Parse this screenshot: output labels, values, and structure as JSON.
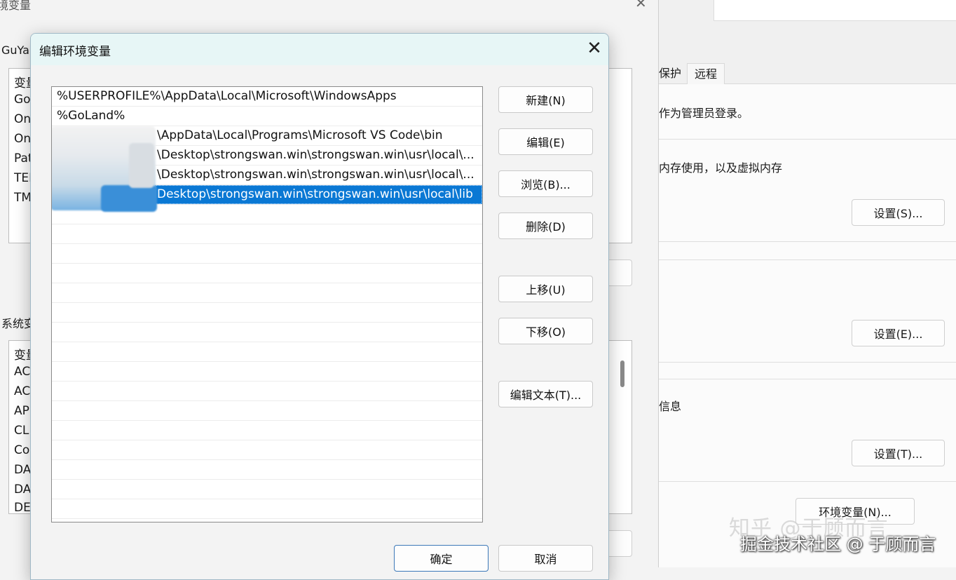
{
  "system_properties": {
    "tabs": [
      "保护",
      "远程"
    ],
    "admin_note": "作为管理员登录。",
    "performance_desc": "内存使用，以及虚拟内存",
    "performance_settings": "设置(S)...",
    "profiles_settings": "设置(E)...",
    "startup_desc": "信息",
    "startup_settings": "设置(T)...",
    "env_vars_button": "环境变量(N)..."
  },
  "env_dialog": {
    "title": "境变量",
    "user_section_label": "GuYa",
    "user_vars_header": "变量",
    "user_vars": [
      "Go",
      "On",
      "On",
      "Pat",
      "TEI",
      "TM"
    ],
    "system_section_label": "系统变",
    "system_vars_header": "变量",
    "system_vars": [
      "AC",
      "AC",
      "AP",
      "CLI",
      "Co",
      "DA",
      "DA",
      "DE"
    ]
  },
  "edit_dialog": {
    "title": "编辑环境变量",
    "paths": [
      {
        "text": "%USERPROFILE%\\AppData\\Local\\Microsoft\\WindowsApps",
        "selected": false
      },
      {
        "text": "%GoLand%",
        "selected": false
      },
      {
        "text": "\\AppData\\Local\\Programs\\Microsoft VS Code\\bin",
        "selected": false
      },
      {
        "text": "\\Desktop\\strongswan.win\\strongswan.win\\usr\\local\\...",
        "selected": false
      },
      {
        "text": "\\Desktop\\strongswan.win\\strongswan.win\\usr\\local\\...",
        "selected": false
      },
      {
        "text": "Desktop\\strongswan.win\\strongswan.win\\usr\\local\\lib",
        "selected": true
      }
    ],
    "buttons": {
      "new": "新建(N)",
      "edit": "编辑(E)",
      "browse": "浏览(B)...",
      "delete": "删除(D)",
      "move_up": "上移(U)",
      "move_down": "下移(O)",
      "edit_text": "编辑文本(T)...",
      "ok": "确定",
      "cancel": "取消"
    }
  },
  "watermark": {
    "line1": "知乎 @于顾而言",
    "line2": "掘金技术社区 @ 于顾而言"
  },
  "colors": {
    "selection": "#0a78d4",
    "titlebar": "#e7f6f6",
    "primary_border": "#3c78b8"
  }
}
